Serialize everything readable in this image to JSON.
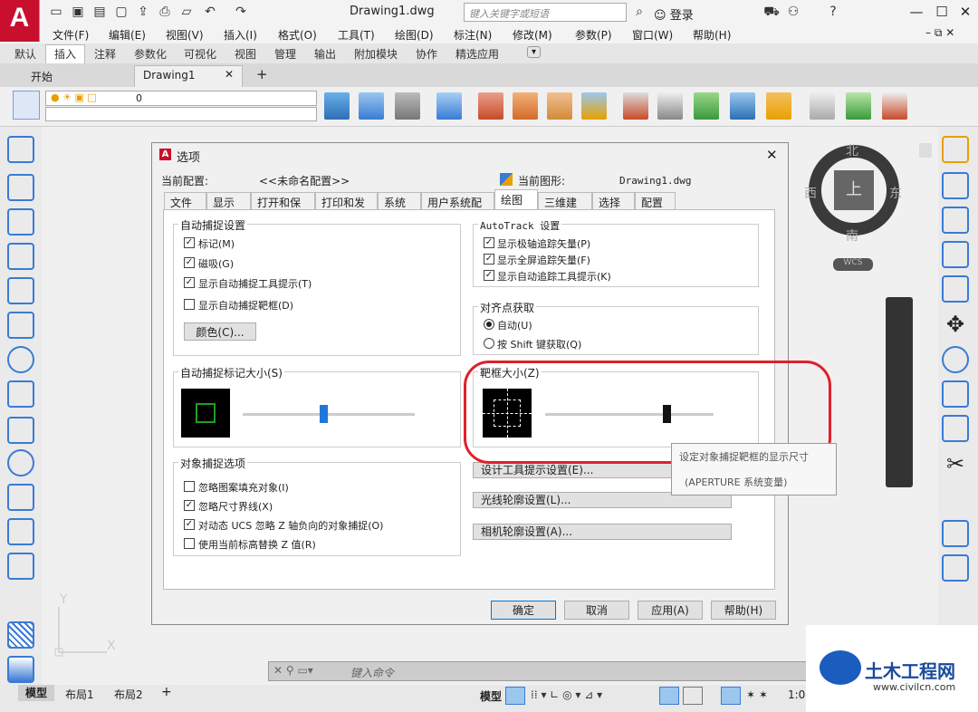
{
  "app": {
    "logo": "A",
    "doc_title": "Drawing1.dwg",
    "search_placeholder": "键入关键字或短语",
    "login": "登录",
    "colors": {
      "brand": "#c8102e",
      "accent": "#3a7bd5",
      "oval": "#e0202a"
    }
  },
  "menu": [
    "文件(F)",
    "编辑(E)",
    "视图(V)",
    "插入(I)",
    "格式(O)",
    "工具(T)",
    "绘图(D)",
    "标注(N)",
    "修改(M)",
    "参数(P)",
    "窗口(W)",
    "帮助(H)"
  ],
  "ribbon_tabs": [
    "默认",
    "插入",
    "注释",
    "参数化",
    "可视化",
    "视图",
    "管理",
    "输出",
    "附加模块",
    "协作",
    "精选应用"
  ],
  "file_tabs": {
    "start": "开始",
    "drawing": "Drawing1"
  },
  "layer_value": "0",
  "viewcube": {
    "north": "北",
    "south": "南",
    "east": "东",
    "west": "西",
    "top": "上",
    "wcs": "WCS"
  },
  "ucs": {
    "x": "X",
    "y": "Y"
  },
  "command_placeholder": "键入命令",
  "layout_tabs": [
    "模型",
    "布局1",
    "布局2"
  ],
  "status_scale": "1:0",
  "dialog": {
    "title": "选项",
    "current_profile_label": "当前配置:",
    "current_profile_value": "<<未命名配置>>",
    "current_drawing_label": "当前图形:",
    "current_drawing_value": "Drawing1.dwg",
    "tabs": [
      "文件",
      "显示",
      "打开和保存",
      "打印和发布",
      "系统",
      "用户系统配置",
      "绘图",
      "三维建模",
      "选择集",
      "配置"
    ],
    "active_tab": "绘图",
    "autosnap": {
      "title": "自动捕捉设置",
      "options": [
        {
          "label": "标记(M)",
          "checked": true
        },
        {
          "label": "磁吸(G)",
          "checked": true
        },
        {
          "label": "显示自动捕捉工具提示(T)",
          "checked": true
        },
        {
          "label": "显示自动捕捉靶框(D)",
          "checked": false
        }
      ],
      "color_button": "颜色(C)..."
    },
    "marker_size": {
      "title": "自动捕捉标记大小(S)",
      "level": 0.47
    },
    "object_snap": {
      "title": "对象捕捉选项",
      "options": [
        {
          "label": "忽略图案填充对象(I)",
          "checked": false
        },
        {
          "label": "忽略尺寸界线(X)",
          "checked": true
        },
        {
          "label": "对动态 UCS 忽略 Z 轴负向的对象捕捉(O)",
          "checked": true
        },
        {
          "label": "使用当前标高替换 Z 值(R)",
          "checked": false
        }
      ]
    },
    "autotrack": {
      "title": "AutoTrack 设置",
      "options": [
        {
          "label": "显示极轴追踪矢量(P)",
          "checked": true
        },
        {
          "label": "显示全屏追踪矢量(F)",
          "checked": true
        },
        {
          "label": "显示自动追踪工具提示(K)",
          "checked": true
        }
      ]
    },
    "alignment": {
      "title": "对齐点获取",
      "options": [
        {
          "label": "自动(U)",
          "selected": true
        },
        {
          "label": "按 Shift 键获取(Q)",
          "selected": false
        }
      ]
    },
    "aperture": {
      "title": "靶框大小(Z)",
      "level": 0.72
    },
    "buttons": {
      "design_tooltip": "设计工具提示设置(E)...",
      "light_glyph": "光线轮廓设置(L)...",
      "camera_glyph": "相机轮廓设置(A)..."
    },
    "tooltip": {
      "line1": "设定对象捕捉靶框的显示尺寸",
      "line2": "(APERTURE 系统变量)"
    },
    "footer": {
      "ok": "确定",
      "cancel": "取消",
      "apply": "应用(A)",
      "help": "帮助(H)"
    }
  },
  "watermark": {
    "title": "土木工程网",
    "url": "www.civilcn.com"
  }
}
